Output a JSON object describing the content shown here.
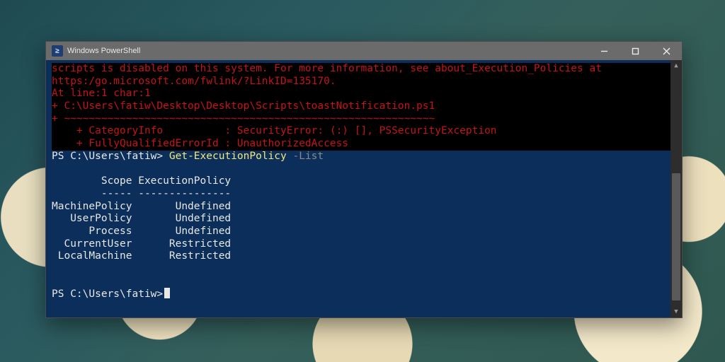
{
  "window": {
    "title": "Windows PowerShell",
    "icon_glyph": "≥"
  },
  "terminal": {
    "error_lines": [
      "scripts is disabled on this system. For more information, see about_Execution_Policies at",
      "https:/go.microsoft.com/fwlink/?LinkID=135170.",
      "At line:1 char:1",
      "+ C:\\Users\\fatiw\\Desktop\\Desktop\\Scripts\\toastNotification.ps1",
      "+ ~~~~~~~~~~~~~~~~~~~~~~~~~~~~~~~~~~~~~~~~~~~~~~~~~~~~~~~~~~~~",
      "    + CategoryInfo          : SecurityError: (:) [], PSSecurityException",
      "    + FullyQualifiedErrorId : UnauthorizedAccess"
    ],
    "prompt1_prefix": "PS C:\\Users\\fatiw> ",
    "command": "Get-ExecutionPolicy",
    "command_arg": " -List",
    "blank": " ",
    "table_header": "        Scope ExecutionPolicy",
    "table_divider": "        ----- ---------------",
    "rows": [
      "MachinePolicy       Undefined",
      "   UserPolicy       Undefined",
      "      Process       Undefined",
      "  CurrentUser      Restricted",
      " LocalMachine      Restricted"
    ],
    "blank2": " ",
    "blank3": " ",
    "prompt2": "PS C:\\Users\\fatiw>"
  }
}
